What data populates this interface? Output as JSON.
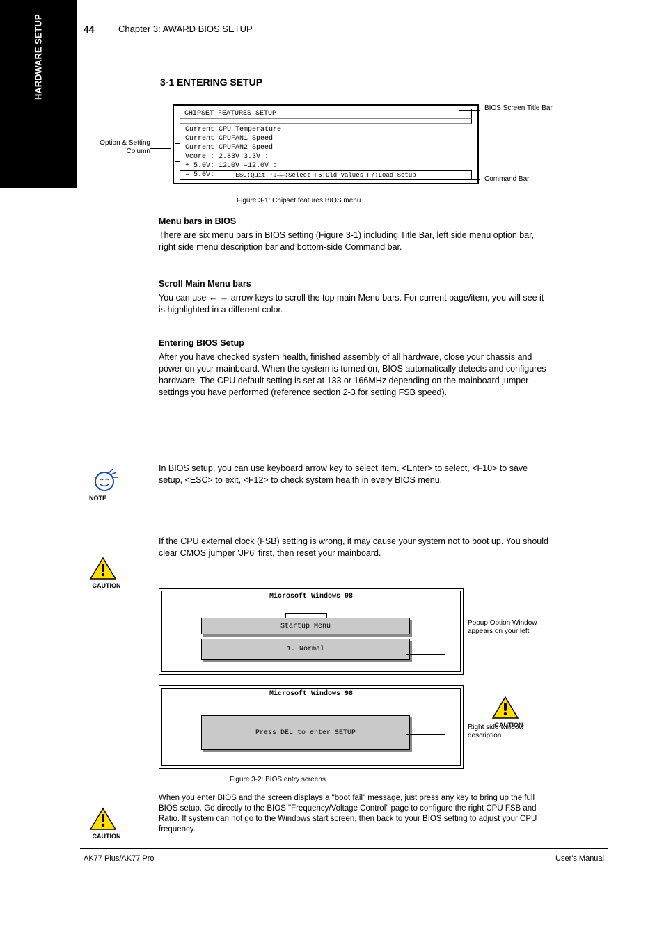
{
  "page_number": "44",
  "chapter_header": "Chapter 3: AWARD BIOS SETUP",
  "sidebar": "HARDWARE SETUP",
  "section": "3-1 ENTERING SETUP",
  "bios": {
    "top_row": "CHIPSET FEATURES SETUP",
    "options": [
      "Current CPU Temperature",
      "Current CPUFAN1 Speed",
      "Current CPUFAN2 Speed",
      "Vcore  :    2.83V      3.3V :",
      "+ 5.0V:   12.0V     –12.0V :",
      "– 5.0V:"
    ],
    "footer": "ESC:Quit   ↑↓→←:Select  F5:Old Values  F7:Load Setup"
  },
  "callouts": {
    "bios_title": "BIOS Screen Title Bar",
    "options": "Option & Setting Column",
    "command": "Command Bar",
    "popup": "Popup Option Window appears on your left",
    "right_desc": "Right side window description"
  },
  "bios_caption": "Figure 3-1: Chipset features BIOS menu",
  "para1_head": " Menu bars in BIOS",
  "para1_body": "There are six menu bars in BIOS setting (Figure 3-1) including Title Bar, left side menu option bar, right side menu description bar and bottom-side Command bar.",
  "para2_head": " Scroll Main Menu bars",
  "para2_body": "You can use ← → arrow keys to scroll the top main Menu bars. For current page/item, you will see it is highlighted in a different color.",
  "note_para1": "In BIOS setup, you can use keyboard arrow key to select item. <Enter> to select, <F10> to save setup, <ESC> to exit, <F12> to check system health in every BIOS menu.",
  "para3_head": " Entering BIOS Setup",
  "para3_body": "After you have checked system health, finished assembly of all hardware, close your chassis and power on your mainboard. When the system is turned on, BIOS automatically detects and configures hardware. The CPU default setting is set at 133 or 166MHz depending on the mainboard jumper settings you have performed (reference section 2-3 for setting FSB speed).",
  "caution_text1": "If the CPU external clock (FSB) setting is wrong, it may cause your system not to boot up. You should clear CMOS jumper 'JP6' first, then reset your mainboard.",
  "sys1": {
    "title": "Microsoft Windows 98",
    "bar1": "Startup Menu",
    "bar2": "1. Normal"
  },
  "sys2": {
    "title": "Microsoft Windows 98",
    "bar": "Press DEL to enter SETUP"
  },
  "sys_caption": "Figure 3-2: BIOS entry screens",
  "caution_text2": "When you enter BIOS and the screen displays a \"boot fail\" message, just press any key to bring up the full BIOS setup. Go directly to the BIOS \"Frequency/Voltage Control\" page to configure the right CPU FSB and Ratio. If system can not go to the Windows start screen, then back to your BIOS setting to adjust your CPU frequency.",
  "footer_left": "AK77 Plus/AK77 Pro",
  "footer_right": "User's Manual"
}
